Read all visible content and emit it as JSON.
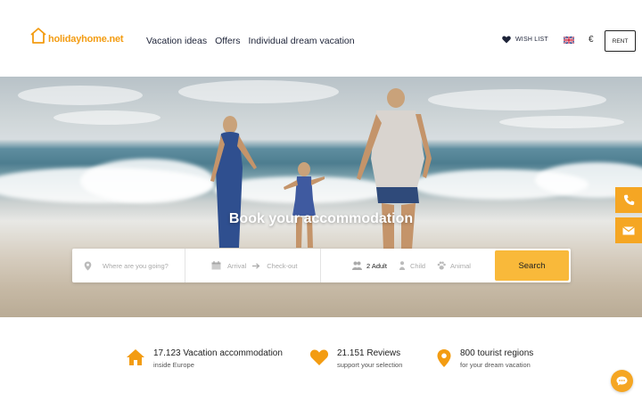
{
  "brand": {
    "name": "holidayhome.net",
    "accent": "#f39c12"
  },
  "nav": {
    "items": [
      {
        "label": "Vacation ideas"
      },
      {
        "label": "Offers"
      },
      {
        "label": "Individual dream vacation"
      }
    ]
  },
  "header": {
    "wishlist_label": "WISH LIST",
    "currency": "€",
    "language_flag": "uk-flag-icon",
    "rent_label": "RENT"
  },
  "hero": {
    "title": "Book your accommodation"
  },
  "search": {
    "where_placeholder": "Where are you going?",
    "arrival_label": "Arrival",
    "checkout_label": "Check-out",
    "adults": "2 Adult",
    "child_label": "Child",
    "animal_label": "Animal",
    "button_label": "Search",
    "button_color": "#f9b93a"
  },
  "features": [
    {
      "title": "17.123 Vacation accommodation",
      "subtitle": "inside Europe",
      "icon": "house-icon"
    },
    {
      "title": "21.151 Reviews",
      "subtitle": "support your selection",
      "icon": "heart-icon"
    },
    {
      "title": "800 tourist regions",
      "subtitle": "for your dream vacation",
      "icon": "map-pin-icon"
    }
  ]
}
